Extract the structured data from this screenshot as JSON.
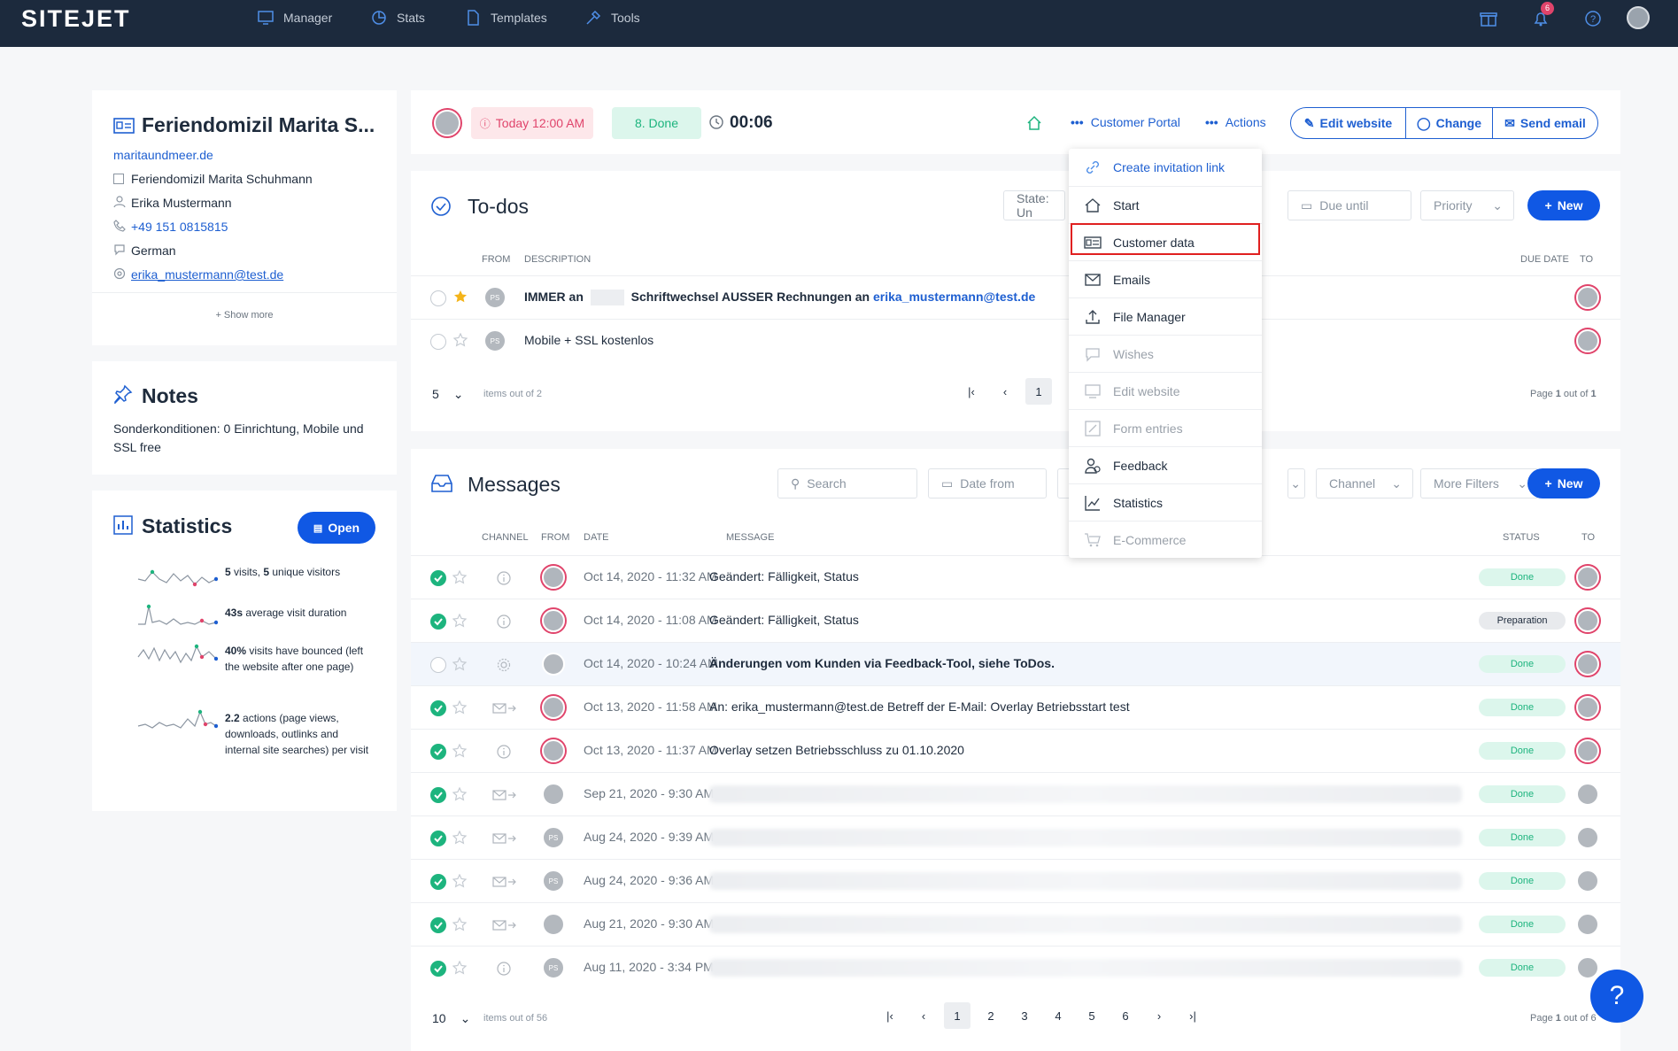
{
  "topbar": {
    "logo": "SITEJET",
    "nav": [
      {
        "label": "Manager",
        "icon": "monitor-icon"
      },
      {
        "label": "Stats",
        "icon": "stats-icon"
      },
      {
        "label": "Templates",
        "icon": "document-icon"
      },
      {
        "label": "Tools",
        "icon": "tools-icon"
      }
    ],
    "notification_count": "6"
  },
  "customer": {
    "title": "Feriendomizil Marita S...",
    "website": "maritaundmeer.de",
    "company": "Feriendomizil Marita Schuhmann",
    "contact": "Erika Mustermann",
    "phone": "+49 151 0815815",
    "language": "German",
    "email": "erika_mustermann@test.de",
    "show_more": "+ Show more"
  },
  "notes": {
    "title": "Notes",
    "text": "Sonderkonditionen: 0 Einrichtung, Mobile und SSL free"
  },
  "statistics": {
    "title": "Statistics",
    "open_label": "Open",
    "items": [
      {
        "bold": "5",
        "text1": " visits, ",
        "bold2": "5",
        "text2": " unique visitors"
      },
      {
        "bold": "43s",
        "text1": " average visit duration",
        "bold2": "",
        "text2": ""
      },
      {
        "bold": "40%",
        "text1": " visits have bounced (left the website after one page)",
        "bold2": "",
        "text2": ""
      },
      {
        "bold": "2.2",
        "text1": " actions (page views, downloads, outlinks and internal site searches) per visit",
        "bold2": "",
        "text2": ""
      }
    ]
  },
  "header_bar": {
    "due": "Today 12:00 AM",
    "status": "8. Done",
    "timer": "00:06",
    "customer_portal": "Customer Portal",
    "actions": "Actions",
    "edit_website": "Edit website",
    "change": "Change",
    "send_email": "Send email"
  },
  "todos": {
    "title": "To-dos",
    "filter_state": "State: Un",
    "filter_due": "Due until",
    "filter_priority": "Priority",
    "new_label": "New",
    "col_from": "FROM",
    "col_description": "DESCRIPTION",
    "col_due": "DUE DATE",
    "col_to": "TO",
    "rows": [
      {
        "from": "PS",
        "text_a": "IMMER an",
        "text_b": "Schriftwechsel AUSSER Rechnungen an",
        "link": "erika_mustermann@test.de",
        "starred": true
      },
      {
        "from": "PS",
        "text_a": "Mobile + SSL kostenlos",
        "text_b": "",
        "link": "",
        "starred": false
      }
    ],
    "per_page": "5",
    "items_out_of": "items out of 2",
    "page": "1",
    "page_info_a": "Page ",
    "page_info_b": "1",
    "page_info_c": " out of ",
    "page_info_d": "1"
  },
  "messages": {
    "title": "Messages",
    "search_placeholder": "Search",
    "date_from": "Date from",
    "channel": "Channel",
    "more_filters": "More Filters",
    "new_label": "New",
    "col_channel": "CHANNEL",
    "col_from": "FROM",
    "col_date": "DATE",
    "col_message": "MESSAGE",
    "col_status": "STATUS",
    "col_to": "TO",
    "rows": [
      {
        "date": "Oct 14, 2020 - 11:32 AM",
        "message": "Geändert: Fälligkeit, Status",
        "status": "Done",
        "bold": false
      },
      {
        "date": "Oct 14, 2020 - 11:08 AM",
        "message": "Geändert: Fälligkeit, Status",
        "status": "Preparation",
        "bold": false
      },
      {
        "date": "Oct 14, 2020 - 10:24 AM",
        "message": "Änderungen vom Kunden via Feedback-Tool, siehe ToDos.",
        "status": "Done",
        "bold": true
      },
      {
        "date": "Oct 13, 2020 - 11:58 AM",
        "message": "An: erika_mustermann@test.de Betreff der E-Mail: Overlay Betriebsstart test",
        "status": "Done",
        "bold": false
      },
      {
        "date": "Oct 13, 2020 - 11:37 AM",
        "message": "Overlay setzen Betriebsschluss zu 01.10.2020",
        "status": "Done",
        "bold": false
      },
      {
        "date": "Sep 21, 2020 - 9:30 AM",
        "message": "",
        "status": "Done",
        "bold": false
      },
      {
        "date": "Aug 24, 2020 - 9:39 AM",
        "message": "",
        "status": "Done",
        "bold": false
      },
      {
        "date": "Aug 24, 2020 - 9:36 AM",
        "message": "",
        "status": "Done",
        "bold": false
      },
      {
        "date": "Aug 21, 2020 - 9:30 AM",
        "message": "",
        "status": "Done",
        "bold": false
      },
      {
        "date": "Aug 11, 2020 - 3:34 PM",
        "message": "",
        "status": "Done",
        "bold": false
      }
    ],
    "per_page": "10",
    "items_out_of": "items out of 56",
    "pages": [
      "1",
      "2",
      "3",
      "4",
      "5",
      "6"
    ],
    "page_info_a": "Page ",
    "page_info_b": "1",
    "page_info_c": " out of 6"
  },
  "actions_menu": {
    "items": [
      {
        "label": "Create invitation link",
        "icon": "link-icon",
        "enabled": true,
        "highlight": false,
        "link": true
      },
      {
        "label": "Start",
        "icon": "home-icon",
        "enabled": true,
        "highlight": false,
        "link": false
      },
      {
        "label": "Customer data",
        "icon": "id-card-icon",
        "enabled": true,
        "highlight": true,
        "link": false
      },
      {
        "label": "Emails",
        "icon": "mail-icon",
        "enabled": true,
        "highlight": false,
        "link": false
      },
      {
        "label": "File Manager",
        "icon": "upload-icon",
        "enabled": true,
        "highlight": false,
        "link": false
      },
      {
        "label": "Wishes",
        "icon": "speech-bubble-icon",
        "enabled": false,
        "highlight": false,
        "link": false
      },
      {
        "label": "Edit website",
        "icon": "monitor-icon",
        "enabled": false,
        "highlight": false,
        "link": false
      },
      {
        "label": "Form entries",
        "icon": "edit-form-icon",
        "enabled": false,
        "highlight": false,
        "link": false
      },
      {
        "label": "Feedback",
        "icon": "user-feedback-icon",
        "enabled": true,
        "highlight": false,
        "link": false
      },
      {
        "label": "Statistics",
        "icon": "chart-icon",
        "enabled": true,
        "highlight": false,
        "link": false
      },
      {
        "label": "E-Commerce",
        "icon": "cart-icon",
        "enabled": false,
        "highlight": false,
        "link": false
      }
    ]
  },
  "help_label": "?"
}
